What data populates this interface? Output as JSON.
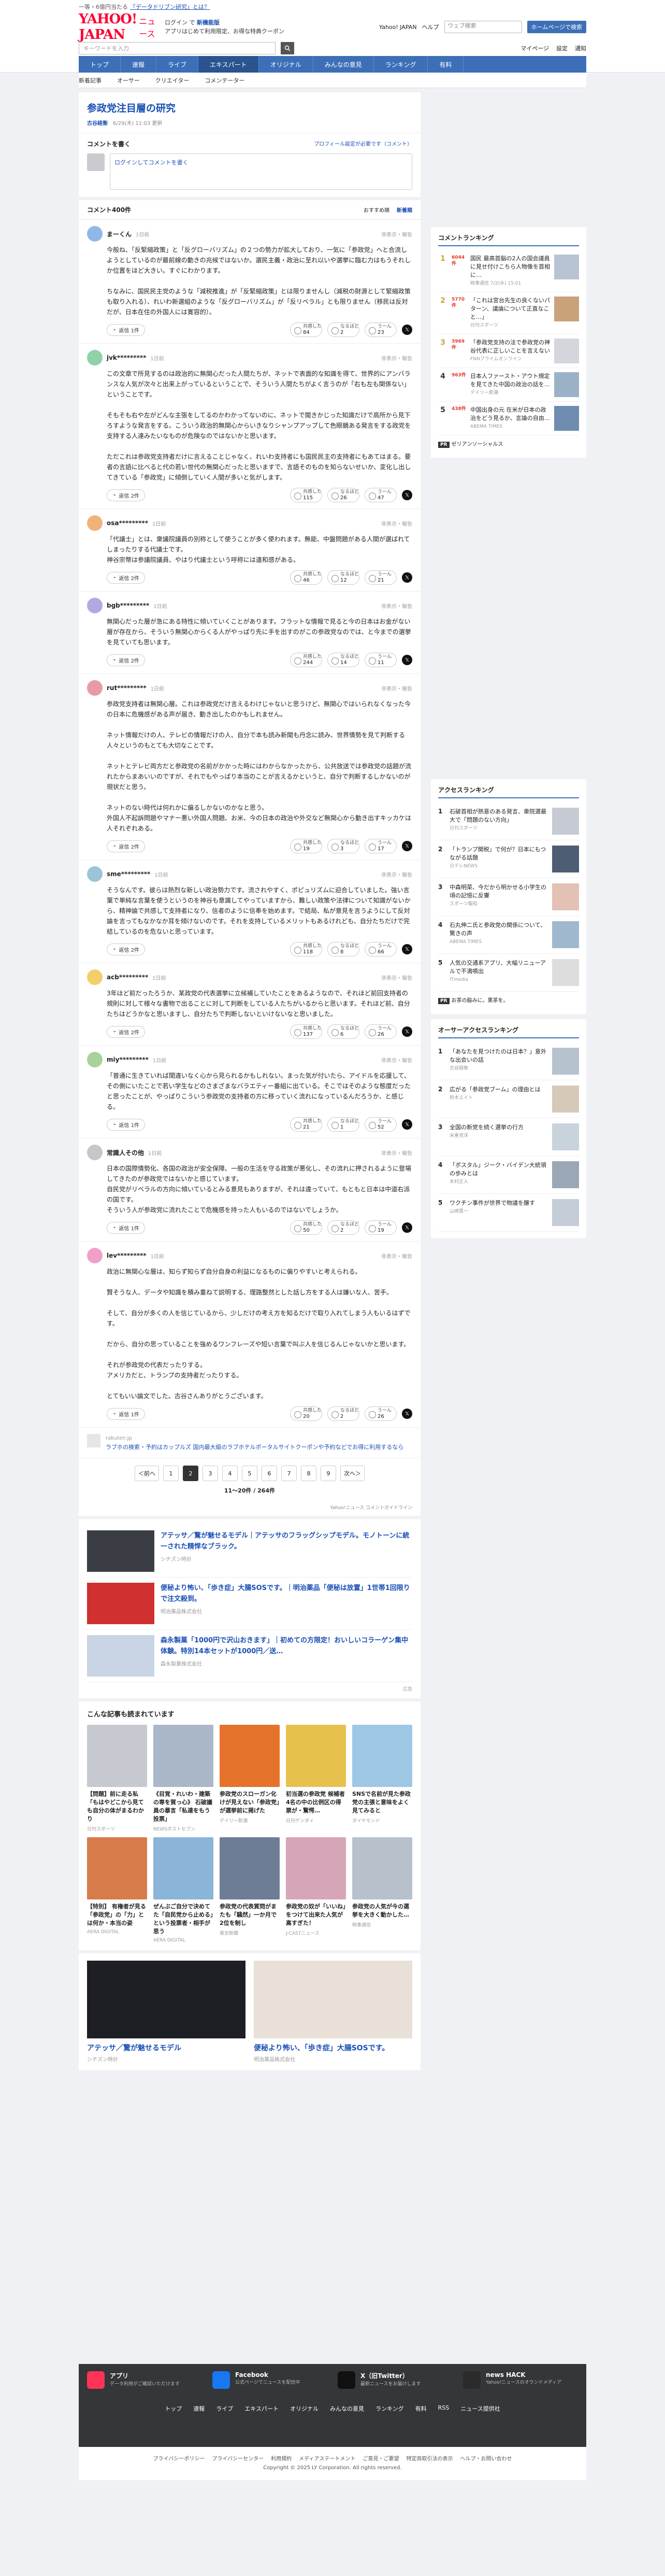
{
  "header": {
    "topline_text": "一等・6億円当たる",
    "topline_link": "「データドリブン研究」とは？",
    "logo": "YAHOO! JAPAN",
    "logo_sub": "ニュース",
    "promo_line1": "ログイン で",
    "promo_link": "新機能版",
    "promo_line2": "アプリはじめて利用限定、お得な特典クーポン",
    "yjapan": "Yahoo! JAPAN",
    "help": "ヘルプ",
    "hdr_search_placeholder": "ウェブ検索",
    "hdr_search_btn": "ホームページで検索",
    "search_placeholder": "キーワードを入力",
    "my_page": "マイページ",
    "menu": "設定",
    "notify": "通知"
  },
  "nav": [
    "トップ",
    "速報",
    "ライブ",
    "エキスパート",
    "オリジナル",
    "みんなの意見",
    "ランキング",
    "有料"
  ],
  "nav_active": 3,
  "subnav": [
    "新着記事",
    "オーサー",
    "クリエイター",
    "コメンテーター"
  ],
  "article": {
    "title": "参政党注目層の研究",
    "author": "古谷経衡",
    "date": "6/29(木) 11:03 更新"
  },
  "comment_form": {
    "heading": "コメントを書く",
    "policy": "プロフィール設定が必要です（コメント）",
    "login": "ログインしてコメントを書く"
  },
  "clist": {
    "count": "コメント400件",
    "sort1": "おすすめ順",
    "sort2": "新着順"
  },
  "reply_label": "返信",
  "report_label": "非表示・報告",
  "react_labels": [
    "共感した",
    "なるほど",
    "うーん"
  ],
  "comments": [
    {
      "user": "まーくん",
      "time": "1日前",
      "color": "#8fb8e8",
      "text": "今般ね、「反緊縮政策」と「反グローバリズム」の２つの勢力が拡大しており、一気に「参政党」へと合流しようとしているのが最前線の動きの兆候ではないか。選民主義・政治に至れ以いや選挙に臨む力はもうそれしか位置をほど大きい。すぐにわかります。\n\nちなみに、国民民主党のような「減税推進」が「反緊縮政策」とは限りませんし（減税の財源として緊縮政策も取り入れる）、れいわ新選組のような「反グローバリズム」が「反リベラル」とも限りません（移民は反対だが、日本在住の外国人には寛容的）。",
      "reply": "返信 1件",
      "r": [
        "84",
        "2",
        "23"
      ]
    },
    {
      "user": "jvk*********",
      "time": "1日前",
      "color": "#8fd1a8",
      "text": "この文章で所見するのは政治的に無関心だった人間たちが、ネットで表面的な知識を得て、世界的にアンバランスな人気が次々と出来上がっているということで、そういう人間たちがよく言うのが「右も左も関係ない」ということです。\n\nそもそも右や左がどんな主張をしてるのかわかってないのに、ネットで聞きかじった知識だけで高所から見下ろすような発言をする。こういう政治的無関心からいきなりシャンプアップして色眼鏡ある発言をする政党を支持する人達みたいなものが危険なのではないかと思います。\n\nただこれは参政党支持者だけに言えることじゃなく、れいわ支持者にも国民民主の支持者にもあてはまる。要者の言語に比べると代の若い世代の無関心だったと思いますで、言語そのものを知らないせいか、変化し出してきている「参政党」に傾倒していく人間が多いと気がします。",
      "reply": "返信 2件",
      "r": [
        "115",
        "26",
        "47"
      ]
    },
    {
      "user": "osa*********",
      "time": "1日前",
      "color": "#f1b27a",
      "text": "「代議士」とは、衆議院議員の別称として使うことが多く使われます。無能、中盤問題がある人間が選ばれてしまったりする代議士です。\n神谷宗幣は参議院議員、やはり代議士という呼称には違和感がある。",
      "reply": "返信 2件",
      "r": [
        "46",
        "12",
        "21"
      ]
    },
    {
      "user": "bgb*********",
      "time": "1日前",
      "color": "#b5a7e0",
      "text": "無関心だった層が急にある特性に傾いていくことがあります。フラットな情報で見ると今の日本はお金がない層が存在から、そういう無関心からくる人がやっぱり先に手を出すのがこの参政党なのでは、と今までの選挙を見ていても思います。",
      "reply": "返信 2件",
      "r": [
        "244",
        "14",
        "11"
      ]
    },
    {
      "user": "rut*********",
      "time": "1日前",
      "color": "#e89aa8",
      "text": "参政党支持者は無関心層。これは参政党だけ言えるわけじゃないと思うけど、無関心ではいられなくなった今の日本に危機感がある声が届き、動き出したのかもしれません。\n\nネット情報だけの人、テレビの情報だけの人、自分で本も読み新聞も丹念に読み、世界情勢を見て判断する人々というのもとても大切なことです。\n\nネットとテレビ両方だと参政党の名前がかかった時にはわからなかったから、公共放送では参政党の話題が流れたからまあいいのですが、それでもやっぱり本当のことが言えるかというと、自分で判断するしかないのが現状だと思う。\n\nネットのない時代は何れかに偏るしかないのかなと思う。\n外国人不起訴問題やマナー悪い外国人問題、お米、今の日本の政治や外交など無関心から動き出すキッカケは人それぞれある。",
      "reply": "返信 2件",
      "r": [
        "19",
        "3",
        "17"
      ]
    },
    {
      "user": "sme*********",
      "time": "1日前",
      "color": "#9cc4d8",
      "text": "そうなんです。彼らは熱烈な新しい政治勢力です。流されやすく、ポピュリズムに迎合していました。強い言葉で単純な言葉を使うというのを神谷も意識してやっていますから、難しい政策や法律について知識がないから、精神論で共感して支持者になり、信者のように信奉を始めます。で結局、私が意見を言うようにして反対論を言ってもなかなか耳を傾けないのです。それを支持しているメリットもあるけれども、自分たちだけで完結しているのを危ないと思っています。",
      "reply": "返信 2件",
      "r": [
        "118",
        "8",
        "66"
      ]
    },
    {
      "user": "acb*********",
      "time": "1日前",
      "color": "#f3cf6c",
      "text": "3年ほど前だったろうか、某政党の代表選挙に立候補していたことをあるようなので、それほど前回支持者の規則に対して様々な書物で出ることに対して判断をしている人たちがいるからと思います。それほど前、自分たちはどうかなと思いますし、自分たちで判断しないといけないなと思いました。",
      "reply": "返信 2件",
      "r": [
        "137",
        "6",
        "26"
      ]
    },
    {
      "user": "miy*********",
      "time": "1日前",
      "color": "#a7d39b",
      "text": "「普通に生きていれば間違いなく心から見られるかもしれない。まった気が付いたら、アイドルを応援して、その側にいたことで若い学生などのさまざまなバラエティー番組に出ている。そこではそのような態度だったと思ったことが、やっぱりこういう参政党の支持者の方に移っていく流れになっているんだろうか、と感じる。",
      "reply": "返信 1件",
      "r": [
        "21",
        "1",
        "52"
      ]
    },
    {
      "user": "常識人その他",
      "time": "1日前",
      "color": "#c5c7cc",
      "text": "日本の国際情勢化、各国の政治が安全保障、一般の生活を守る政策が悪化し、その流れに押されるように登場してきたのが参政党ではないかと感じています。\n自民党がリベラルの方向に傾いているとみる意見もありますが、それは違っていて、もともと日本は中道右派の国です。\nそういう人が参政党に流れたことで危機感を持った人もいるのではないでしょうか。",
      "reply": "返信 1件",
      "r": [
        "50",
        "2",
        "19"
      ]
    },
    {
      "user": "lev*********",
      "time": "1日前",
      "color": "#f0a0c8",
      "text": "政治に無関心な層は、知らず知らず自分自身の利益になるものに偏りやすいと考えられる。\n\n賢そうな人、データや知識を積み重ねて説明する、理路整然とした話し方をする人は嫌いな人、苦手。\n\nそして、自分が多くの人を信じているから、少しだけの考え方を知るだけで取り入れてしまう人もいるはずです。\n\nだから、自分の思っていることを強めるワンフレーズや短い言葉で叫ぶ人を信じるんじゃないかと思います。\n\nそれが参政党の代表だったりする。\nアメリカだと、トランプの支持者だったりする。\n\nとてもいい論文でした。古谷さんありがとうございます。",
      "reply": "返信 1件",
      "r": [
        "20",
        "2",
        "26"
      ]
    }
  ],
  "inline_ad": {
    "sponsor": "rakuten.jp",
    "text": "ラブホの検索・予約はカップルズ 国内最大級のラブホテルポータルサイトクーポンや予約などでお得に利用するなら"
  },
  "pager": {
    "prev": "＜前へ",
    "pages": [
      "1",
      "2",
      "3",
      "4",
      "5",
      "6",
      "7",
      "8",
      "9"
    ],
    "current": 1,
    "next": "次へ＞",
    "count": "11〜20件 / 264件",
    "guide": "Yahoo!ニュース コメントガイドライン"
  },
  "ads": [
    {
      "title": "アテッサ／驚が魅せるモデル｜アテッサのフラッグシップモデル。モノトーンに統一された精悍なブラック。",
      "sub": "シチズン時計",
      "color": "#3a3d44"
    },
    {
      "title": "便秘より怖い、「歩き症」大腸SOSです。｜明治薬品「便秘は放置」1世帯1回限りで注文殺到。",
      "sub": "明治薬品株式会社",
      "color": "#d0302f"
    },
    {
      "title": "森永製菓「1000円で沢山おきます」｜初めての方限定！おいしいコラーゲン集中体験。特別14本セットが1000円／送…",
      "sub": "森永製菓株式会社",
      "color": "#c9d5e4"
    }
  ],
  "ad_mark": "広告",
  "recs_title": "こんな記事も読まれています",
  "recs": [
    {
      "t": "【問題】前に走る私「もはやどこから見ても自分の体がまるわかり",
      "s": "日刊スポーツ",
      "c": "#c6c9cf"
    },
    {
      "t": "《目覚・れいわ・建築の専を賀っ心》 石破議員の暴言「私達をもう投票」",
      "s": "NEWSポストセブン",
      "c": "#a9b7c9"
    },
    {
      "t": "参政党のスローガン化けが見えない「参政党」が選挙前に掲げた",
      "s": "デイリー新潮",
      "c": "#e5722b"
    },
    {
      "t": "初当選の参政党 候補者4名の中の比例区の得票が・驚愕…",
      "s": "日刊ゲンダイ",
      "c": "#e6c14c"
    },
    {
      "t": "SNSで名前が見た参政党の主張と意味をよく見てみると",
      "s": "ダイヤモンド",
      "c": "#9ec7e6"
    },
    {
      "t": "【特別】 有権者が見る「参政党」の「力」とは何か・本当の姿",
      "s": "AERA DIGITAL",
      "c": "#d87b4a"
    },
    {
      "t": "ぜんぶご自分で決めてた「自民党から止める」という投票者・相手が思う",
      "s": "AERA DIGITAL",
      "c": "#8ab4d8"
    },
    {
      "t": "参政党の代表質問がまたも「騒然」一か月で2位を制し",
      "s": "東京新聞",
      "c": "#6e7d96"
    },
    {
      "t": "参政党の奴が「いいね」をつけて出来た人気が高すぎた！",
      "s": "J-CASTニュース",
      "c": "#d7a5b8"
    },
    {
      "t": "参政党の人気が今の選挙を大きく動かした…",
      "s": "時事通信",
      "c": "#b7c1cc"
    }
  ],
  "bigads": [
    {
      "t": "アテッサ／驚が魅せるモデル",
      "s": "シチズン時計",
      "c": "#1d1f24"
    },
    {
      "t": "便秘より怖い、「歩き症」大腸SOSです。",
      "s": "明治薬品株式会社",
      "c": "#e9e1d7"
    }
  ],
  "side": {
    "comment_ranking": "コメントランキング",
    "cranks": [
      {
        "n": "1",
        "cnt": "6044件",
        "t": "国民 最高首脳の2人の国会議員に見せ付けこちら人物像を首相に…",
        "s": "時事通信 7/2(水) 15:01",
        "c": "#b8c4d4"
      },
      {
        "n": "2",
        "cnt": "5770件",
        "t": "「これは宮台先生の良くないパターン、議論について正直なこと…」",
        "s": "日刊スポーツ",
        "c": "#caa27a"
      },
      {
        "n": "3",
        "cnt": "3969件",
        "t": "「参政党支持の法で参政党の神谷代表に正しいことを言えない",
        "s": "FNNプライムオンライン",
        "c": "#d3d6da"
      },
      {
        "n": "4",
        "cnt": "963件",
        "t": "日本人ファースト・アウト規定を見てきた中国の政治の話を…",
        "s": "デイリー新潮",
        "c": "#9bb1c8"
      },
      {
        "n": "5",
        "cnt": "438件",
        "t": "中国出身の元 在米が日本の政治をどう見るか、言論の自由…",
        "s": "ABEMA TIMES",
        "c": "#6e8cb0"
      }
    ],
    "pr_label": "PR",
    "pr_text": "ゼリアンソーシャルス",
    "access_ranking": "アクセスランキング",
    "aranks": [
      {
        "n": "1",
        "t": "石破首相が熱意のある発言、衆院選最大で「問題のない方向」",
        "s": "日刊スポーツ",
        "c": "#c6cbd3"
      },
      {
        "n": "2",
        "t": "「トランプ関税」で何が？日本にもつながる話題",
        "s": "日テレNEWS",
        "c": "#4e5d73"
      },
      {
        "n": "3",
        "t": "中森明菜、今だから明かせる小学生の頃の記憶に反響",
        "s": "スポーツ報知",
        "c": "#e3c2b4"
      },
      {
        "n": "4",
        "t": "石丸伸二氏と参政党の関係について、驚きの声",
        "s": "ABEMA TIMES",
        "c": "#9fb8ce"
      },
      {
        "n": "5",
        "t": "人気の交通系アプリ、大幅リニューアルで不満噴出",
        "s": "ITmedia",
        "c": "#ddd"
      }
    ],
    "pr2_text": "お茶の脇みに。黒茶を。",
    "author_ranking": "オーサーアクセスランキング",
    "authrank": [
      {
        "n": "1",
        "t": "「あなたを見つけたのは日本？」意外な出会いの話",
        "s": "古谷経衡",
        "c": "#b7c2cf"
      },
      {
        "n": "2",
        "t": "広がる「参政党ブーム」の理由とは",
        "s": "鈴木エイト",
        "c": "#d7c9b8"
      },
      {
        "n": "3",
        "t": "全国の新党を続く選挙の行方",
        "s": "米重克洋",
        "c": "#c8d3dc"
      },
      {
        "n": "4",
        "t": "「ポスタル」ジーク・バイデン大統領の歩みとは",
        "s": "木村正人",
        "c": "#9aa7b5"
      },
      {
        "n": "5",
        "t": "ワクチン事件が世界で物議を醸す",
        "s": "山崎晋一",
        "c": "#c4cdd8"
      }
    ]
  },
  "footer": {
    "apps": [
      {
        "t": "アプリ",
        "s": "データ利用がご確認いただけます",
        "c": "#ff3355"
      },
      {
        "t": "Facebook",
        "s": "公式ページでニュースを配信中",
        "c": "#1877f2"
      },
      {
        "t": "X（旧Twitter）",
        "s": "最新ニュースをお届けします",
        "c": "#111"
      },
      {
        "t": "news HACK",
        "s": "Yahoo!ニュースのオウンドメディア",
        "c": "#2b2b2b"
      }
    ],
    "links": [
      "トップ",
      "速報",
      "ライブ",
      "エキスパート",
      "オリジナル",
      "みんなの意見",
      "ランキング",
      "有料",
      "RSS",
      "ニュース提供社"
    ],
    "legal": [
      "プライバシーポリシー",
      "プライバシーセンター",
      "利用規約",
      "メディアステートメント",
      "ご意見・ご要望",
      "特定商取引法の表示",
      "ヘルプ・お問い合わせ"
    ],
    "copy": "Copyright © 2025 LY Corporation. All rights reserved."
  }
}
